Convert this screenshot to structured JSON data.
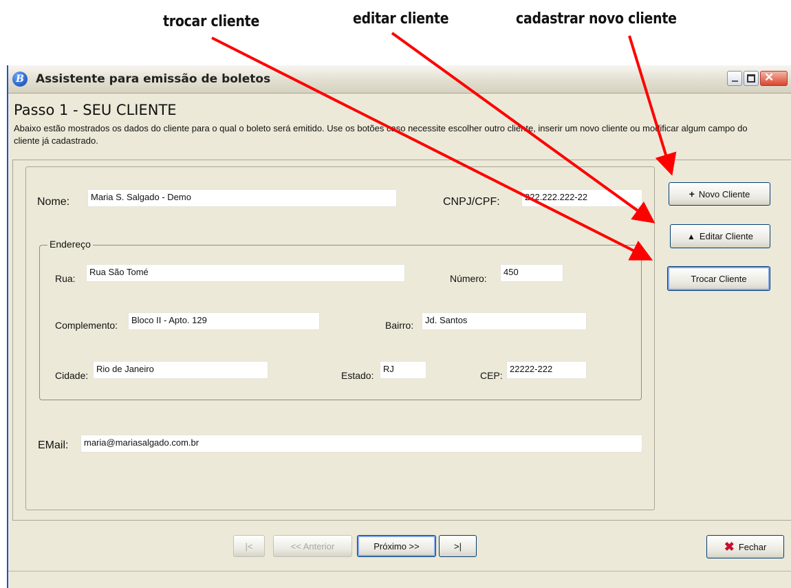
{
  "annotations": {
    "trocar": "trocar cliente",
    "editar": "editar cliente",
    "cadastrar": "cadastrar novo cliente"
  },
  "window": {
    "title": "Assistente para emissão de boletos"
  },
  "step": {
    "title": "Passo 1 - SEU CLIENTE",
    "description": "Abaixo estão mostrados os dados do cliente para o qual o boleto será emitido. Use os botões caso necessite escolher outro cliente, inserir um novo cliente ou modificar algum campo do cliente já cadastrado."
  },
  "form": {
    "nome_label": "Nome:",
    "nome_value": "Maria S. Salgado - Demo",
    "cnpj_label": "CNPJ/CPF:",
    "cnpj_value": "222.222.222-22",
    "endereco_legend": "Endereço",
    "rua_label": "Rua:",
    "rua_value": "Rua São Tomé",
    "numero_label": "Número:",
    "numero_value": "450",
    "complemento_label": "Complemento:",
    "complemento_value": "Bloco II - Apto. 129",
    "bairro_label": "Bairro:",
    "bairro_value": "Jd. Santos",
    "cidade_label": "Cidade:",
    "cidade_value": "Rio de Janeiro",
    "estado_label": "Estado:",
    "estado_value": "RJ",
    "cep_label": "CEP:",
    "cep_value": "22222-222",
    "email_label": "EMail:",
    "email_value": "maria@mariasalgado.com.br"
  },
  "side_buttons": {
    "novo": "Novo Cliente",
    "novo_icon": "+",
    "editar": "Editar Cliente",
    "editar_icon": "▲",
    "trocar": "Trocar Cliente"
  },
  "nav": {
    "first": "|<",
    "previous": "<< Anterior",
    "next": "Próximo >>",
    "last": ">|",
    "close": "Fechar"
  },
  "colors": {
    "arrow": "#ff0000",
    "window_border": "#1a50d4",
    "button_border": "#003c74"
  }
}
